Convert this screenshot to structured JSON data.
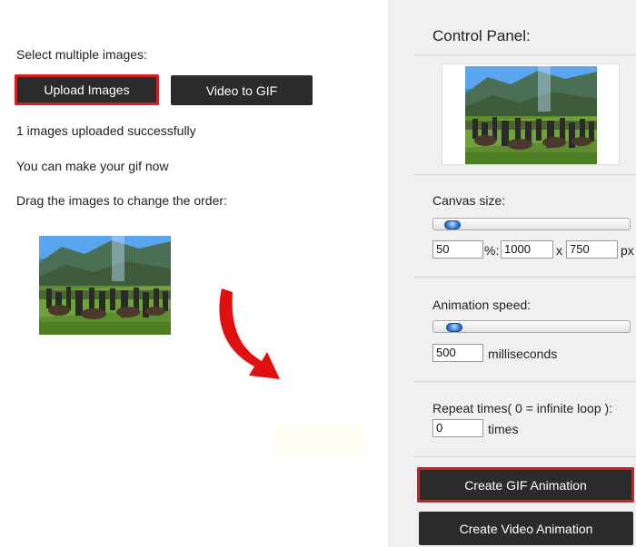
{
  "left": {
    "select_label": "Select multiple images:",
    "upload_button": "Upload Images",
    "video_button": "Video to GIF",
    "status_uploaded": "1 images uploaded successfully",
    "status_ready": "You can make your gif now",
    "drag_hint": "Drag the images to change the order:"
  },
  "panel": {
    "title": "Control Panel:",
    "canvas_label": "Canvas size:",
    "canvas_percent": "50",
    "percent_sep": "%:",
    "canvas_width": "1000",
    "x_sep": "x",
    "canvas_height": "750",
    "px_unit": "px",
    "canvas_slider_level": 0.05,
    "speed_label": "Animation speed:",
    "speed_value": "500",
    "speed_unit": "milliseconds",
    "speed_slider_level": 0.06,
    "repeat_label": "Repeat times( 0 = infinite loop ):",
    "repeat_value": "0",
    "repeat_unit": "times",
    "create_gif_button": "Create GIF Animation",
    "create_video_button": "Create Video Animation"
  },
  "colors": {
    "button_bg": "#2b2b2b",
    "highlight": "#d61e1e",
    "arrow": "#e01010",
    "panel_bg": "#f0f0f0"
  },
  "icons": {
    "annotation": "curved-arrow-icon"
  }
}
